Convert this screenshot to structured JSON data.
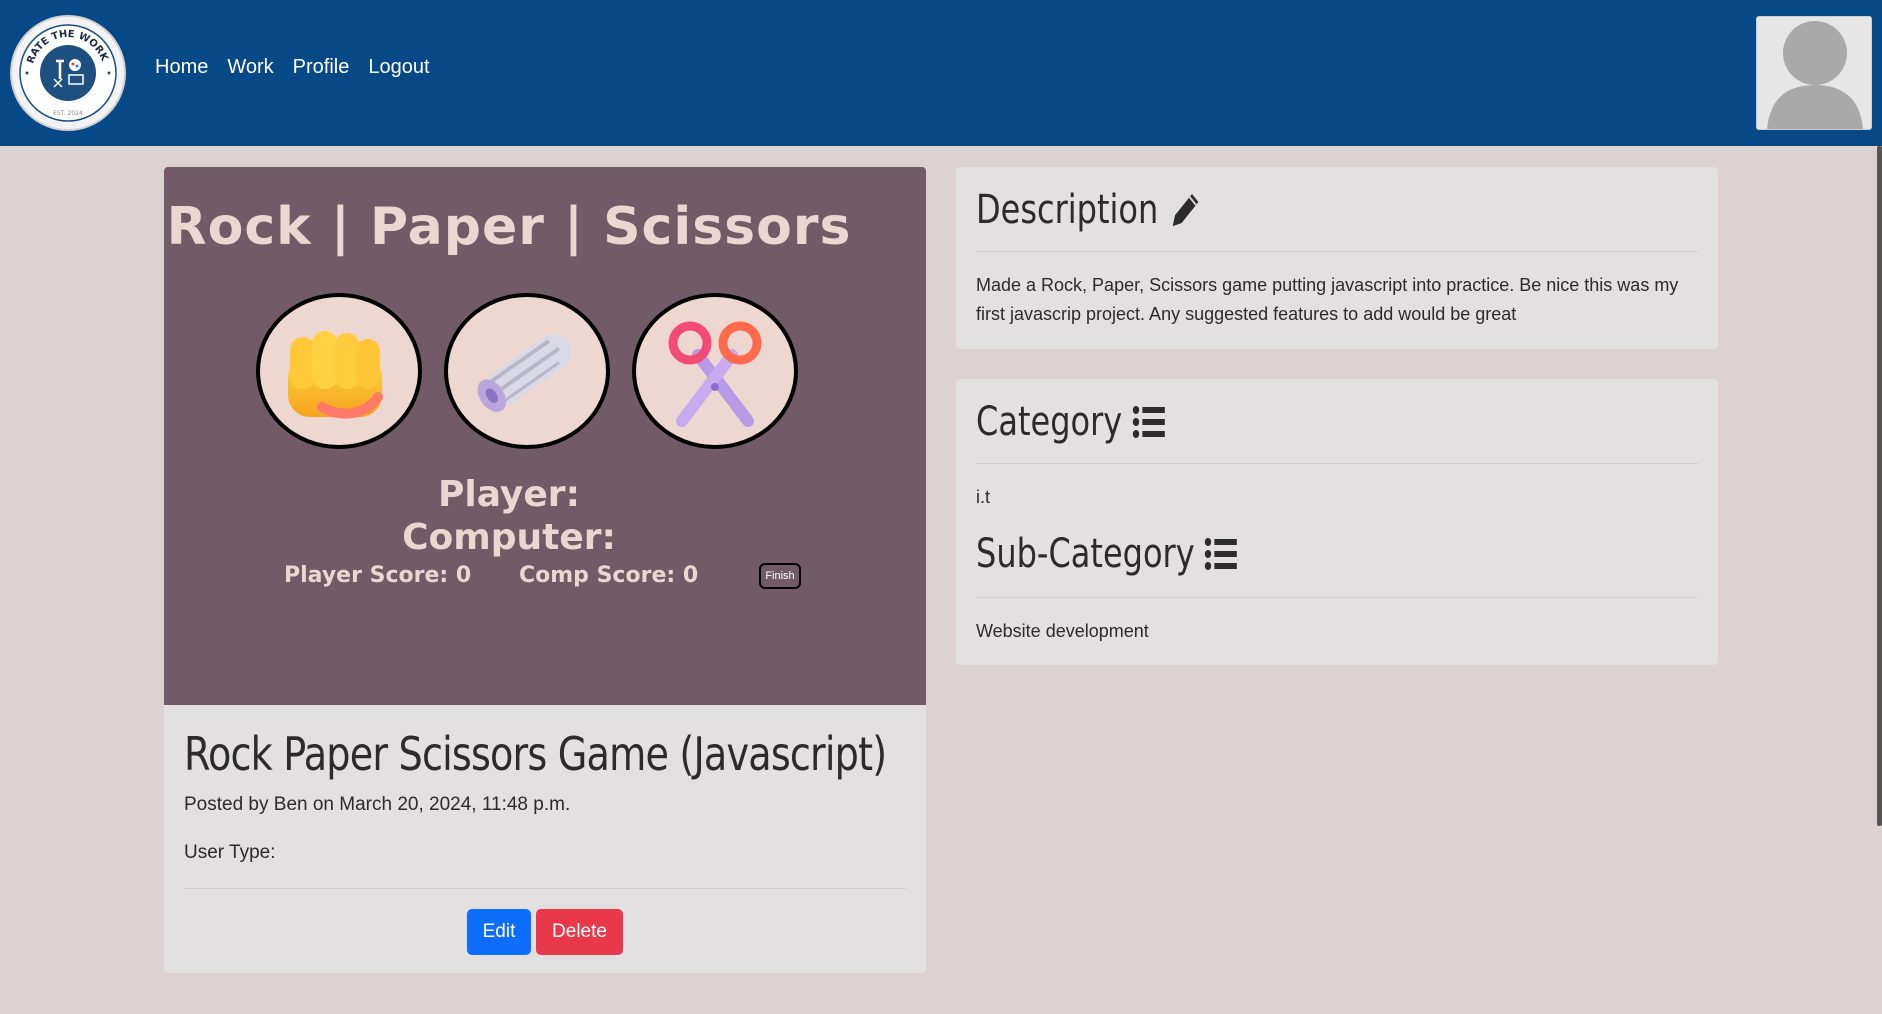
{
  "navbar": {
    "logo_text": "RATE THE WORK",
    "logo_est": "EST. 2024",
    "links": [
      {
        "label": "Home"
      },
      {
        "label": "Work"
      },
      {
        "label": "Profile"
      },
      {
        "label": "Logout"
      }
    ]
  },
  "game": {
    "title": "Rock | Paper | Scissors",
    "choices": [
      {
        "name": "rock",
        "icon": "fist-icon"
      },
      {
        "name": "paper",
        "icon": "paper-roll-icon"
      },
      {
        "name": "scissors",
        "icon": "scissors-icon"
      }
    ],
    "player_label": "Player:",
    "computer_label": "Computer:",
    "player_score_label": "Player Score: 0",
    "comp_score_label": "Comp Score: 0",
    "finish_label": "Finish",
    "colors": {
      "background": "#725a66",
      "text": "#ecd6d2",
      "circle": "#eed7d1"
    }
  },
  "post": {
    "title": "Rock Paper Scissors Game (Javascript)",
    "posted_by": "Posted by Ben on March 20, 2024, 11:48 p.m.",
    "user_type": "User Type:",
    "edit_label": "Edit",
    "delete_label": "Delete"
  },
  "description": {
    "heading": "Description",
    "icon": "pencil-icon",
    "text": "Made a Rock, Paper, Scissors game putting javascript into practice. Be nice this was my first javascrip project. Any suggested features to add would be great"
  },
  "category": {
    "heading": "Category",
    "icon": "list-icon",
    "value": "i.t",
    "sub_heading": "Sub-Category",
    "sub_value": "Website development"
  },
  "colors": {
    "navbar": "#074986",
    "page_bg": "#dcd2d2",
    "card_bg": "#e2e0e0",
    "edit_button": "#0d6efd",
    "delete_button": "#e8384a"
  }
}
